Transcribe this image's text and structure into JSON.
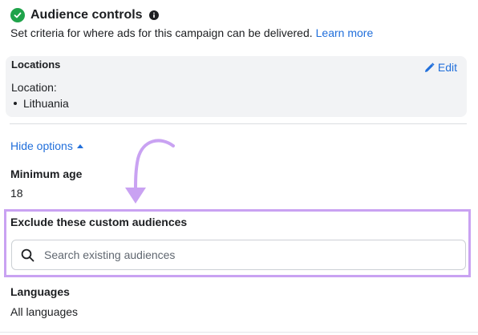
{
  "header": {
    "title": "Audience controls",
    "subtitle": "Set criteria for where ads for this campaign can be delivered.",
    "learn_more": "Learn more"
  },
  "locations": {
    "heading": "Locations",
    "edit_label": "Edit",
    "location_label": "Location:",
    "items": [
      "Lithuania"
    ]
  },
  "options": {
    "hide_options": "Hide options"
  },
  "minimum_age": {
    "label": "Minimum age",
    "value": "18"
  },
  "exclude": {
    "label": "Exclude these custom audiences",
    "search_placeholder": "Search existing audiences"
  },
  "languages": {
    "label": "Languages",
    "value": "All languages"
  },
  "colors": {
    "accent": "#216fdb",
    "success": "#1fa34a",
    "highlight": "#c9a2f2"
  },
  "icons": [
    "check-circle-icon",
    "info-icon",
    "pencil-icon",
    "caret-up-icon",
    "search-icon",
    "arrow-annotation-icon"
  ]
}
